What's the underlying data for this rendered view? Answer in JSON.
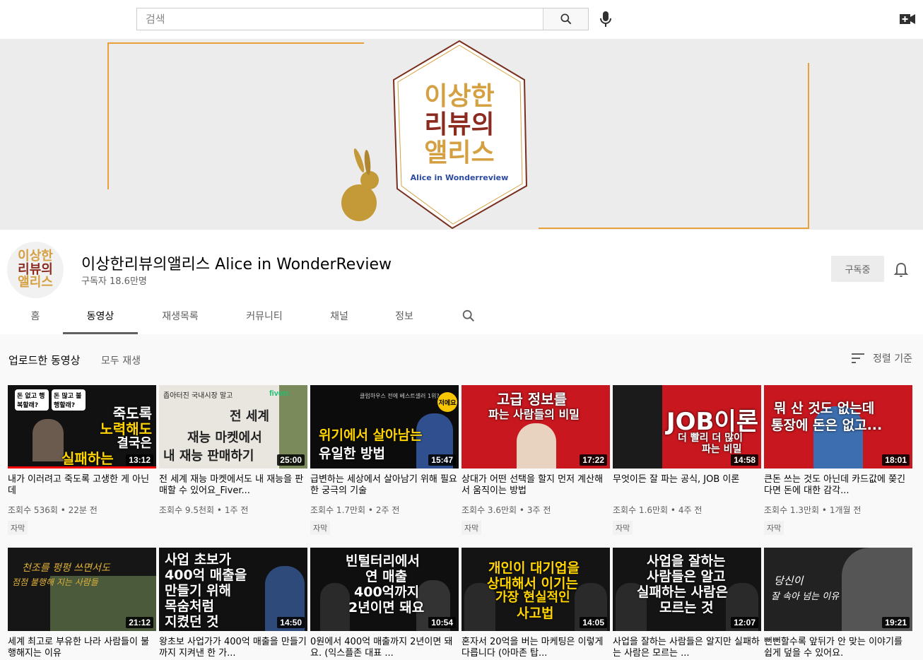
{
  "header": {
    "search_placeholder": "검색",
    "icons": [
      "search-icon",
      "microphone-icon",
      "create-video-icon"
    ]
  },
  "banner": {
    "logo_line1": "이상한",
    "logo_line2": "리뷰의",
    "logo_line3": "앨리스",
    "logo_subtitle": "Alice in Wonderreview"
  },
  "channel": {
    "avatar_line1": "이상한",
    "avatar_line2": "리뷰의",
    "avatar_line3": "앨리스",
    "name": "이상한리뷰의앨리스 Alice in WonderReview",
    "subscribers": "구독자 18.6만명",
    "subscribe_label": "구독중",
    "tabs": [
      "홈",
      "동영상",
      "재생목록",
      "커뮤니티",
      "채널",
      "정보"
    ],
    "active_tab": "동영상"
  },
  "section": {
    "title": "업로드한 동영상",
    "play_all": "모두 재생",
    "sort_label": "정렬 기준"
  },
  "videos": [
    {
      "title": "내가 이러려고 죽도록 고생한 게 아닌데",
      "views": "조회수 536회",
      "age": "22분 전",
      "duration": "13:12",
      "badge": "자막",
      "watched": 1.0
    },
    {
      "title": "전 세계 재능 마켓에서도 내 재능을 판매할 수 있어요_Fiver...",
      "views": "조회수 9.5천회",
      "age": "1주 전",
      "duration": "25:00",
      "badge": "",
      "watched": 0
    },
    {
      "title": "급변하는 세상에서 살아남기 위해 필요한 궁극의 기술",
      "views": "조회수 1.7만회",
      "age": "2주 전",
      "duration": "15:47",
      "badge": "자막",
      "watched": 0
    },
    {
      "title": "상대가 어떤 선택을 할지 먼저 계산해서 움직이는 방법",
      "views": "조회수 3.6만회",
      "age": "3주 전",
      "duration": "17:22",
      "badge": "자막",
      "watched": 0
    },
    {
      "title": "무엇이든 잘 파는 공식, JOB 이론",
      "views": "조회수 1.6만회",
      "age": "4주 전",
      "duration": "14:58",
      "badge": "자막",
      "watched": 0
    },
    {
      "title": "큰돈 쓰는 것도 아닌데 카드값에 쫒긴다면 돈에 대한 감각...",
      "views": "조회수 1.3만회",
      "age": "1개월 전",
      "duration": "18:01",
      "badge": "자막",
      "watched": 0
    },
    {
      "title": "세계 최고로 부유한 나라 사람들이 불행해지는 이유",
      "views": "",
      "age": "",
      "duration": "21:12",
      "badge": "",
      "watched": 0
    },
    {
      "title": "왕초보 사업가가 400억 매출을 만들기까지 지켜낸 한 가...",
      "views": "",
      "age": "",
      "duration": "14:50",
      "badge": "",
      "watched": 0
    },
    {
      "title": "0원에서 400억 매출까지 2년이면 돼요. (익스플존 대표 ...",
      "views": "",
      "age": "",
      "duration": "10:54",
      "badge": "",
      "watched": 0
    },
    {
      "title": "혼자서 20억을 버는 마케팅은 이렇게 다릅니다 (아마존 탑...",
      "views": "",
      "age": "",
      "duration": "14:05",
      "badge": "",
      "watched": 0
    },
    {
      "title": "사업을 잘하는 사람들은 알지만 실패하는 사람은 모르는 ...",
      "views": "",
      "age": "",
      "duration": "12:07",
      "badge": "",
      "watched": 0
    },
    {
      "title": "뻔뻔할수록 앞뒤가 안 맞는 이야기를 쉽게 덮을 수 있어요.",
      "views": "",
      "age": "",
      "duration": "19:21",
      "badge": "",
      "watched": 0
    }
  ],
  "thumb_text": [
    {
      "a": "돈 없고 행복할래?",
      "b": "돈 많고 불행할래?",
      "c": "죽도록",
      "d": "노력해도",
      "e": "결국은",
      "f": "실패하는"
    },
    {
      "a": "좁아터진 국내시장 말고",
      "b": "fiverr.",
      "c": "전 세계",
      "d": "재능 마켓에서",
      "e": "내 재능 판매하기"
    },
    {
      "a": "클럽하우스 전에 베스트셀러 1위?",
      "b": "저에요",
      "c": "위기에서 살아남는",
      "d": "유일한 방법"
    },
    {
      "a": "고급 정보를",
      "b": "파는 사람들의 비밀"
    },
    {
      "a": "JOB이론",
      "b": "더 빨리 더 많이",
      "c": "파는 비밀"
    },
    {
      "a": "뭐 산 것도 없는데",
      "b": "통장에 돈은 없고..."
    },
    {
      "a": "천조를 펑펑 쓰면서도",
      "b": "점점 불행해 지는 사람들"
    },
    {
      "a": "사업 초보가",
      "b": "400억 매출을",
      "c": "만들기 위해",
      "d": "목숨처럼",
      "e": "지켰던 것"
    },
    {
      "a": "빈털터리에서",
      "b": "연 매출",
      "c": "400억까지",
      "d": "2년이면 돼요"
    },
    {
      "a": "개인이 대기업을",
      "b": "상대해서 이기는",
      "c": "가장 현실적인",
      "d": "사고법"
    },
    {
      "a": "사업을 잘하는",
      "b": "사람들은 알고",
      "c": "실패하는 사람은",
      "d": "모르는 것"
    },
    {
      "a": "당신이",
      "b": "잘 속아 넘는 이유"
    }
  ],
  "colors": {
    "accent_red": "#ff0000",
    "thumb_red": "#c8171e",
    "logo_gold": "#d4a042",
    "logo_maroon": "#8b2a1e",
    "logo_blue": "#2b4aa0"
  }
}
